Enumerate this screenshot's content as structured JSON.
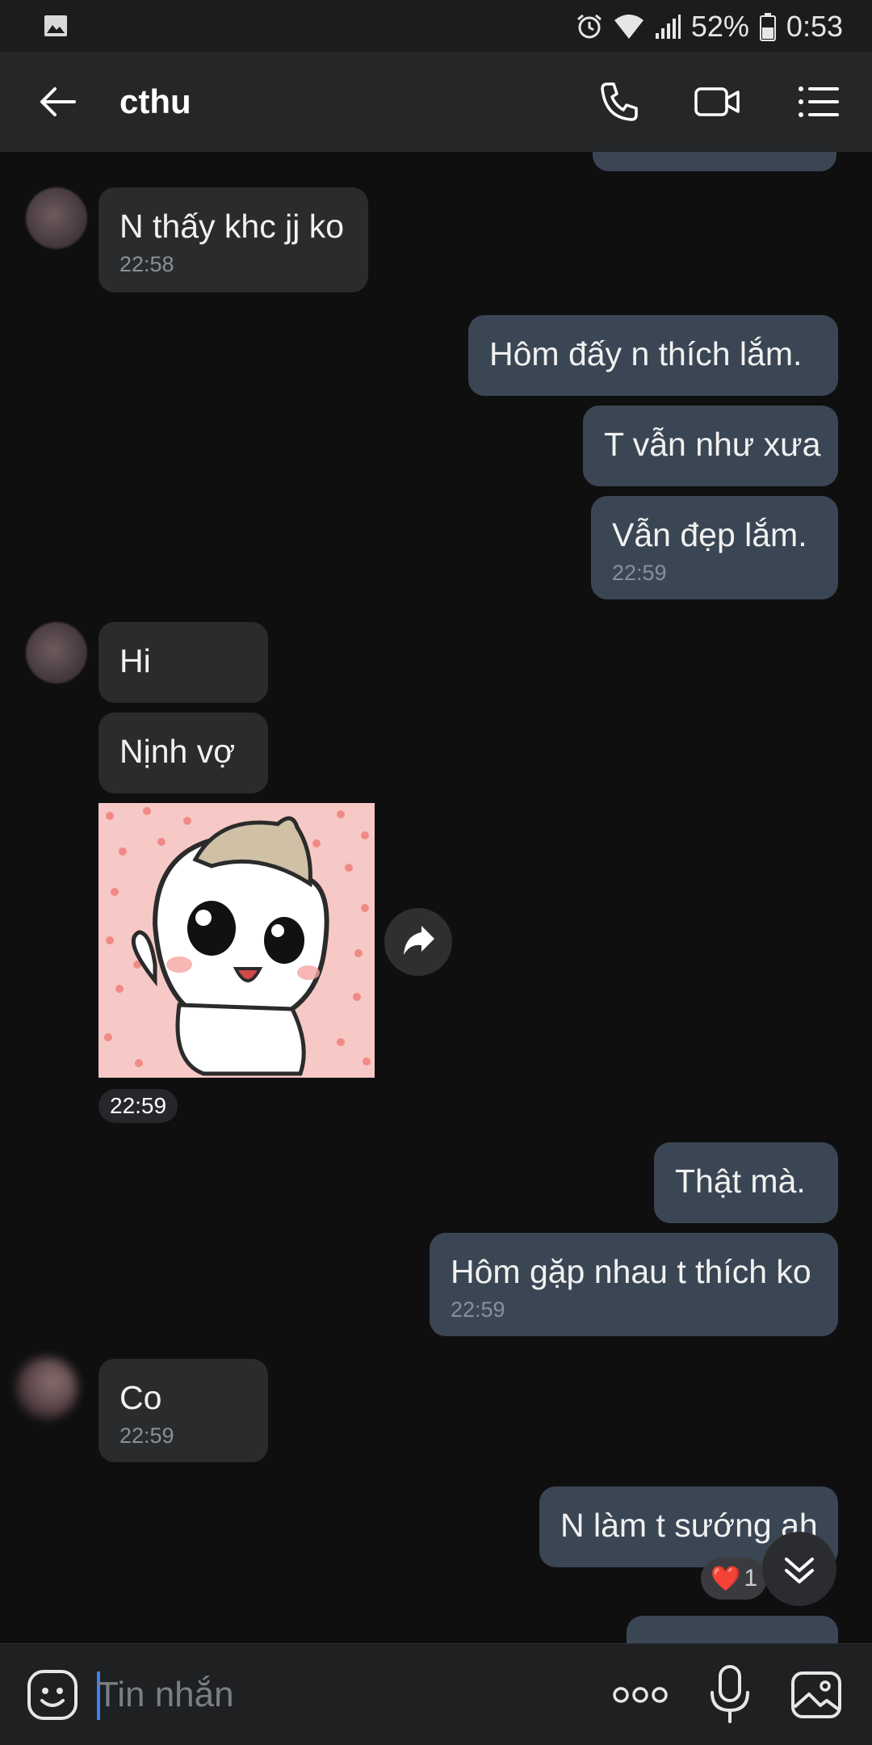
{
  "status_bar": {
    "left_icon": "image-notification-icon",
    "battery": "52%",
    "time": "0:53",
    "icons": [
      "alarm-icon",
      "wifi-icon",
      "signal-icon",
      "battery-icon"
    ]
  },
  "header": {
    "title": "cthu",
    "icons": [
      "back-arrow-icon",
      "phone-icon",
      "video-camera-icon",
      "menu-list-icon"
    ]
  },
  "messages": [
    {
      "side": "in",
      "text": "N thấy khc jj ko",
      "time": "22:58"
    },
    {
      "side": "out",
      "text": "Hôm đấy n thích lắm."
    },
    {
      "side": "out",
      "text": "T vẫn như xưa"
    },
    {
      "side": "out",
      "text": "Vẫn đẹp lắm.",
      "time": "22:59"
    },
    {
      "side": "in",
      "text": "Hi"
    },
    {
      "side": "in",
      "text": "Nịnh vợ"
    },
    {
      "side": "in",
      "type": "sticker",
      "time": "22:59"
    },
    {
      "side": "out",
      "text": "Thật mà."
    },
    {
      "side": "out",
      "text": "Hôm gặp nhau t thích ko",
      "time": "22:59"
    },
    {
      "side": "in",
      "text": "Co",
      "time": "22:59"
    },
    {
      "side": "out",
      "text": "N làm t sướng ah",
      "reaction": {
        "emoji": "❤️",
        "count": "1"
      }
    }
  ],
  "composer": {
    "placeholder": "Tin nhắn",
    "icons": [
      "emoji-icon",
      "more-dots-icon",
      "microphone-icon",
      "gallery-icon"
    ]
  },
  "colors": {
    "background": "#0f0f10",
    "incoming_bubble": "#2a2b2d",
    "outgoing_bubble": "#3b4654",
    "accent": "#3b82f6"
  }
}
